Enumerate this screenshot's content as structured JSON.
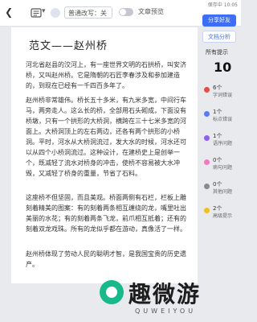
{
  "toolbar": {
    "mode_label": "普通改写：关",
    "toggle_label": "文章预览",
    "status_text": "保存中 10:05"
  },
  "document": {
    "title": "范文——赵州桥",
    "paragraphs": [
      "河北省赵县的洨河上，有一座世界文明的石拱桥，叫安济桥，又叫赵州桥。它是隋朝的石匠李春涉及和参加建造的，到现在已经有一千四百多年了。",
      "赵州桥非常雄伟。桥长五十多米，有九米多宽，中间行车马，两旁走人。这么长的桥，全部用石头砌成，下面没有桥墩，只有一个拱形的大桥洞，横跨在三十七米多宽的河面上。大桥洞顶上的左右两边，还各有两个拱形的小桥洞。平时，河水从大桥洞流过，发大水的时候，河水还可以从四个小桥洞流过。这种设计，在建桥史上是创举一个，既减轻了流水对桥身的冲击，使桥不容易被大水冲毁，又减轻了桥身的重量，节省了石料。",
      "这座桥不但坚固，而且美观。桥面两侧有石栏，栏板上雕刻着精美的图案：有的刻着两条相互缠绕的龙，嘴里吐出美丽的水花；有的刻着两条飞龙，前爪相互抵着；还有的刻着双龙戏珠。所有的龙似乎都在游动，真像活了一样。",
      "赵州桥体现了劳动人民的聪明才智，是我国宝贵的历史遗产。"
    ]
  },
  "panel": {
    "share_button": "分享好友",
    "analysis_button": "文档分析",
    "section_title": "所有提示",
    "total_count": "10",
    "items": [
      {
        "count": "6个",
        "label": "字词错误",
        "color": "#e84a4a"
      },
      {
        "count": "1个",
        "label": "标点错误",
        "color": "#5a7bf0"
      },
      {
        "count": "1个",
        "label": "语序问题",
        "color": "#8e5ff0"
      },
      {
        "count": "0个",
        "label": "病句问题",
        "color": "#f07ac0"
      },
      {
        "count": "0个",
        "label": "其他问题",
        "color": "#8a8a8a"
      },
      {
        "count": "2个",
        "label": "高级提示",
        "color": "#f0c020"
      }
    ]
  },
  "watermark": {
    "text": "趣微游",
    "subtext": "QUWEIYOU"
  }
}
